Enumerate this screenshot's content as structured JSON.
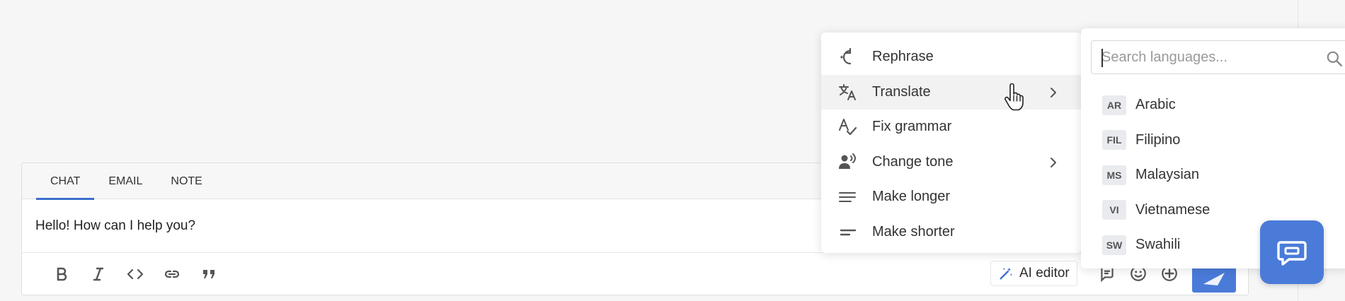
{
  "composer": {
    "tabs": [
      {
        "label": "CHAT",
        "active": true
      },
      {
        "label": "EMAIL",
        "active": false
      },
      {
        "label": "NOTE",
        "active": false
      }
    ],
    "message_text": "Hello! How can I help you?",
    "formatting_icons": [
      "bold-icon",
      "italic-icon",
      "code-icon",
      "link-icon",
      "quote-icon"
    ],
    "ai_editor_label": "AI editor",
    "right_icons": [
      "canned-response-icon",
      "emoji-icon",
      "add-icon",
      "send-icon"
    ]
  },
  "ai_menu": {
    "items": [
      {
        "label": "Rephrase",
        "icon": "sparkle-rephrase-icon",
        "has_submenu": false
      },
      {
        "label": "Translate",
        "icon": "translate-icon",
        "has_submenu": true,
        "hovered": true
      },
      {
        "label": "Fix grammar",
        "icon": "grammar-check-icon",
        "has_submenu": false
      },
      {
        "label": "Change tone",
        "icon": "speaker-tone-icon",
        "has_submenu": true
      },
      {
        "label": "Make longer",
        "icon": "lines-long-icon",
        "has_submenu": false
      },
      {
        "label": "Make shorter",
        "icon": "lines-short-icon",
        "has_submenu": false
      }
    ]
  },
  "language_panel": {
    "search_placeholder": "Search languages...",
    "search_value": "",
    "languages": [
      {
        "code": "AR",
        "name": "Arabic"
      },
      {
        "code": "FIL",
        "name": "Filipino"
      },
      {
        "code": "MS",
        "name": "Malaysian"
      },
      {
        "code": "VI",
        "name": "Vietnamese"
      },
      {
        "code": "SW",
        "name": "Swahili"
      }
    ]
  },
  "colors": {
    "accent": "#4a7bd9",
    "tab_underline": "#3d6fcf",
    "background": "#f6f6f6",
    "code_badge_bg": "#e9ebee"
  },
  "chat_widget": {
    "icon": "chat-bubble-icon"
  }
}
